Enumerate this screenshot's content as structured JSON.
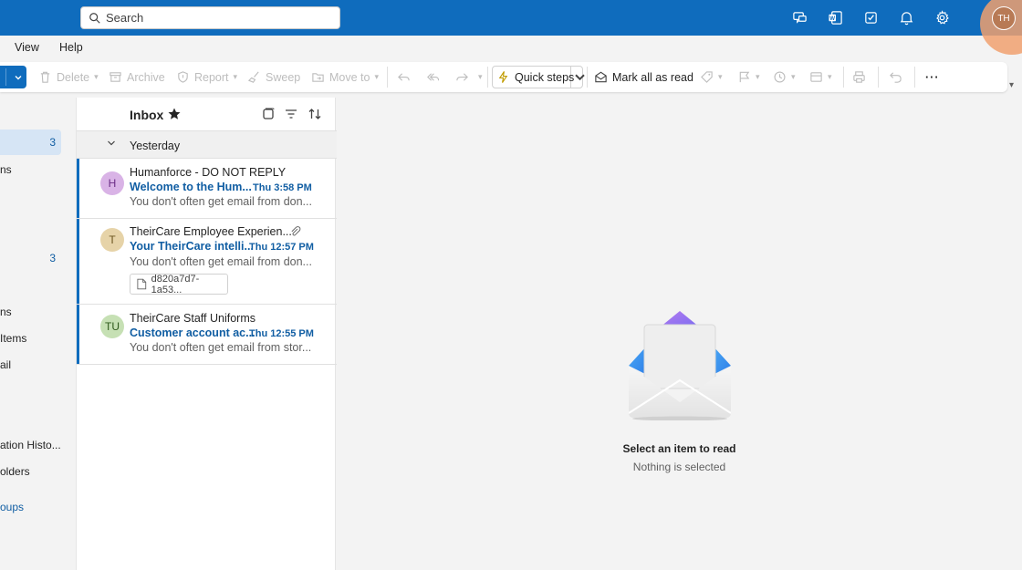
{
  "header": {
    "search_placeholder": "Search",
    "icons": [
      "chat-icon",
      "word-icon",
      "todo-icon",
      "bell-icon",
      "gear-icon"
    ],
    "avatar_initials": "TH",
    "brand_color": "#0f6cbd"
  },
  "menu": {
    "items": [
      "View",
      "Help"
    ]
  },
  "ribbon": {
    "delete": "Delete",
    "archive": "Archive",
    "report": "Report",
    "sweep": "Sweep",
    "move_to": "Move to",
    "quick_steps": "Quick steps",
    "mark_all_read": "Mark all as read",
    "more": "···"
  },
  "folders": [
    {
      "label": "",
      "count": "3",
      "selected": true
    },
    {
      "label": "ns",
      "count": ""
    },
    {
      "label": "",
      "count": "3"
    },
    {
      "label": "ns",
      "count": ""
    },
    {
      "label": "Items",
      "count": ""
    },
    {
      "label": "ail",
      "count": ""
    },
    {
      "label": "ation Histo...",
      "count": ""
    },
    {
      "label": "olders",
      "count": ""
    },
    {
      "label": "oups",
      "count": "",
      "link": true
    }
  ],
  "list": {
    "title": "Inbox",
    "group": "Yesterday",
    "messages": [
      {
        "initials": "H",
        "avatar_color": "#d9b3e6",
        "avatar_text_color": "#6b2d85",
        "sender": "Humanforce - DO NOT REPLY",
        "subject": "Welcome to the Hum...",
        "time": "Thu 3:58 PM",
        "preview": "You don't often get email from don..."
      },
      {
        "initials": "T",
        "avatar_color": "#e6d3a8",
        "avatar_text_color": "#6b5520",
        "sender": "TheirCare Employee Experien...",
        "subject": "Your TheirCare intelli...",
        "time": "Thu 12:57 PM",
        "preview": "You don't often get email from don...",
        "attachment": "d820a7d7-1a53..."
      },
      {
        "initials": "TU",
        "avatar_color": "#c6e0b4",
        "avatar_text_color": "#2f5a1c",
        "sender": "TheirCare Staff Uniforms",
        "subject": "Customer account ac...",
        "time": "Thu 12:55 PM",
        "preview": "You don't often get email from stor..."
      }
    ]
  },
  "reading_pane": {
    "title": "Select an item to read",
    "subtitle": "Nothing is selected"
  }
}
